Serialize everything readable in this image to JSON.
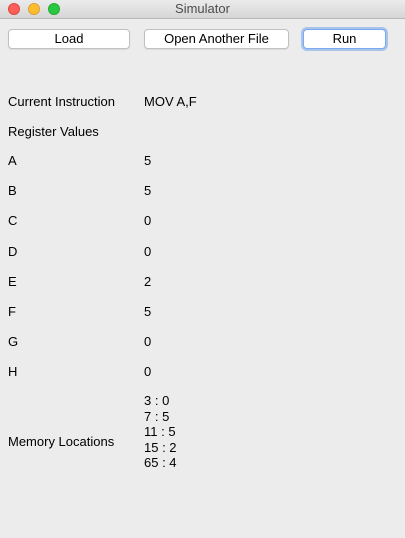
{
  "window": {
    "title": "Simulator"
  },
  "toolbar": {
    "load_label": "Load",
    "open_label": "Open Another File",
    "run_label": "Run"
  },
  "instruction": {
    "label": "Current Instruction",
    "value": "MOV A,F"
  },
  "registers": {
    "heading": "Register Values",
    "items": [
      {
        "name": "A",
        "value": "5"
      },
      {
        "name": "B",
        "value": "5"
      },
      {
        "name": "C",
        "value": "0"
      },
      {
        "name": "D",
        "value": "0"
      },
      {
        "name": "E",
        "value": "2"
      },
      {
        "name": "F",
        "value": "5"
      },
      {
        "name": "G",
        "value": "0"
      },
      {
        "name": "H",
        "value": "0"
      }
    ]
  },
  "memory": {
    "label": "Memory Locations",
    "lines": [
      "3 : 0",
      "7 : 5",
      "11 : 5",
      "15 : 2",
      "65 : 4"
    ]
  },
  "colors": {
    "background": "#ececec",
    "close": "#fc5f57",
    "minimize": "#fdbc2e",
    "maximize": "#28c840",
    "focus_ring": "#5994ec"
  }
}
